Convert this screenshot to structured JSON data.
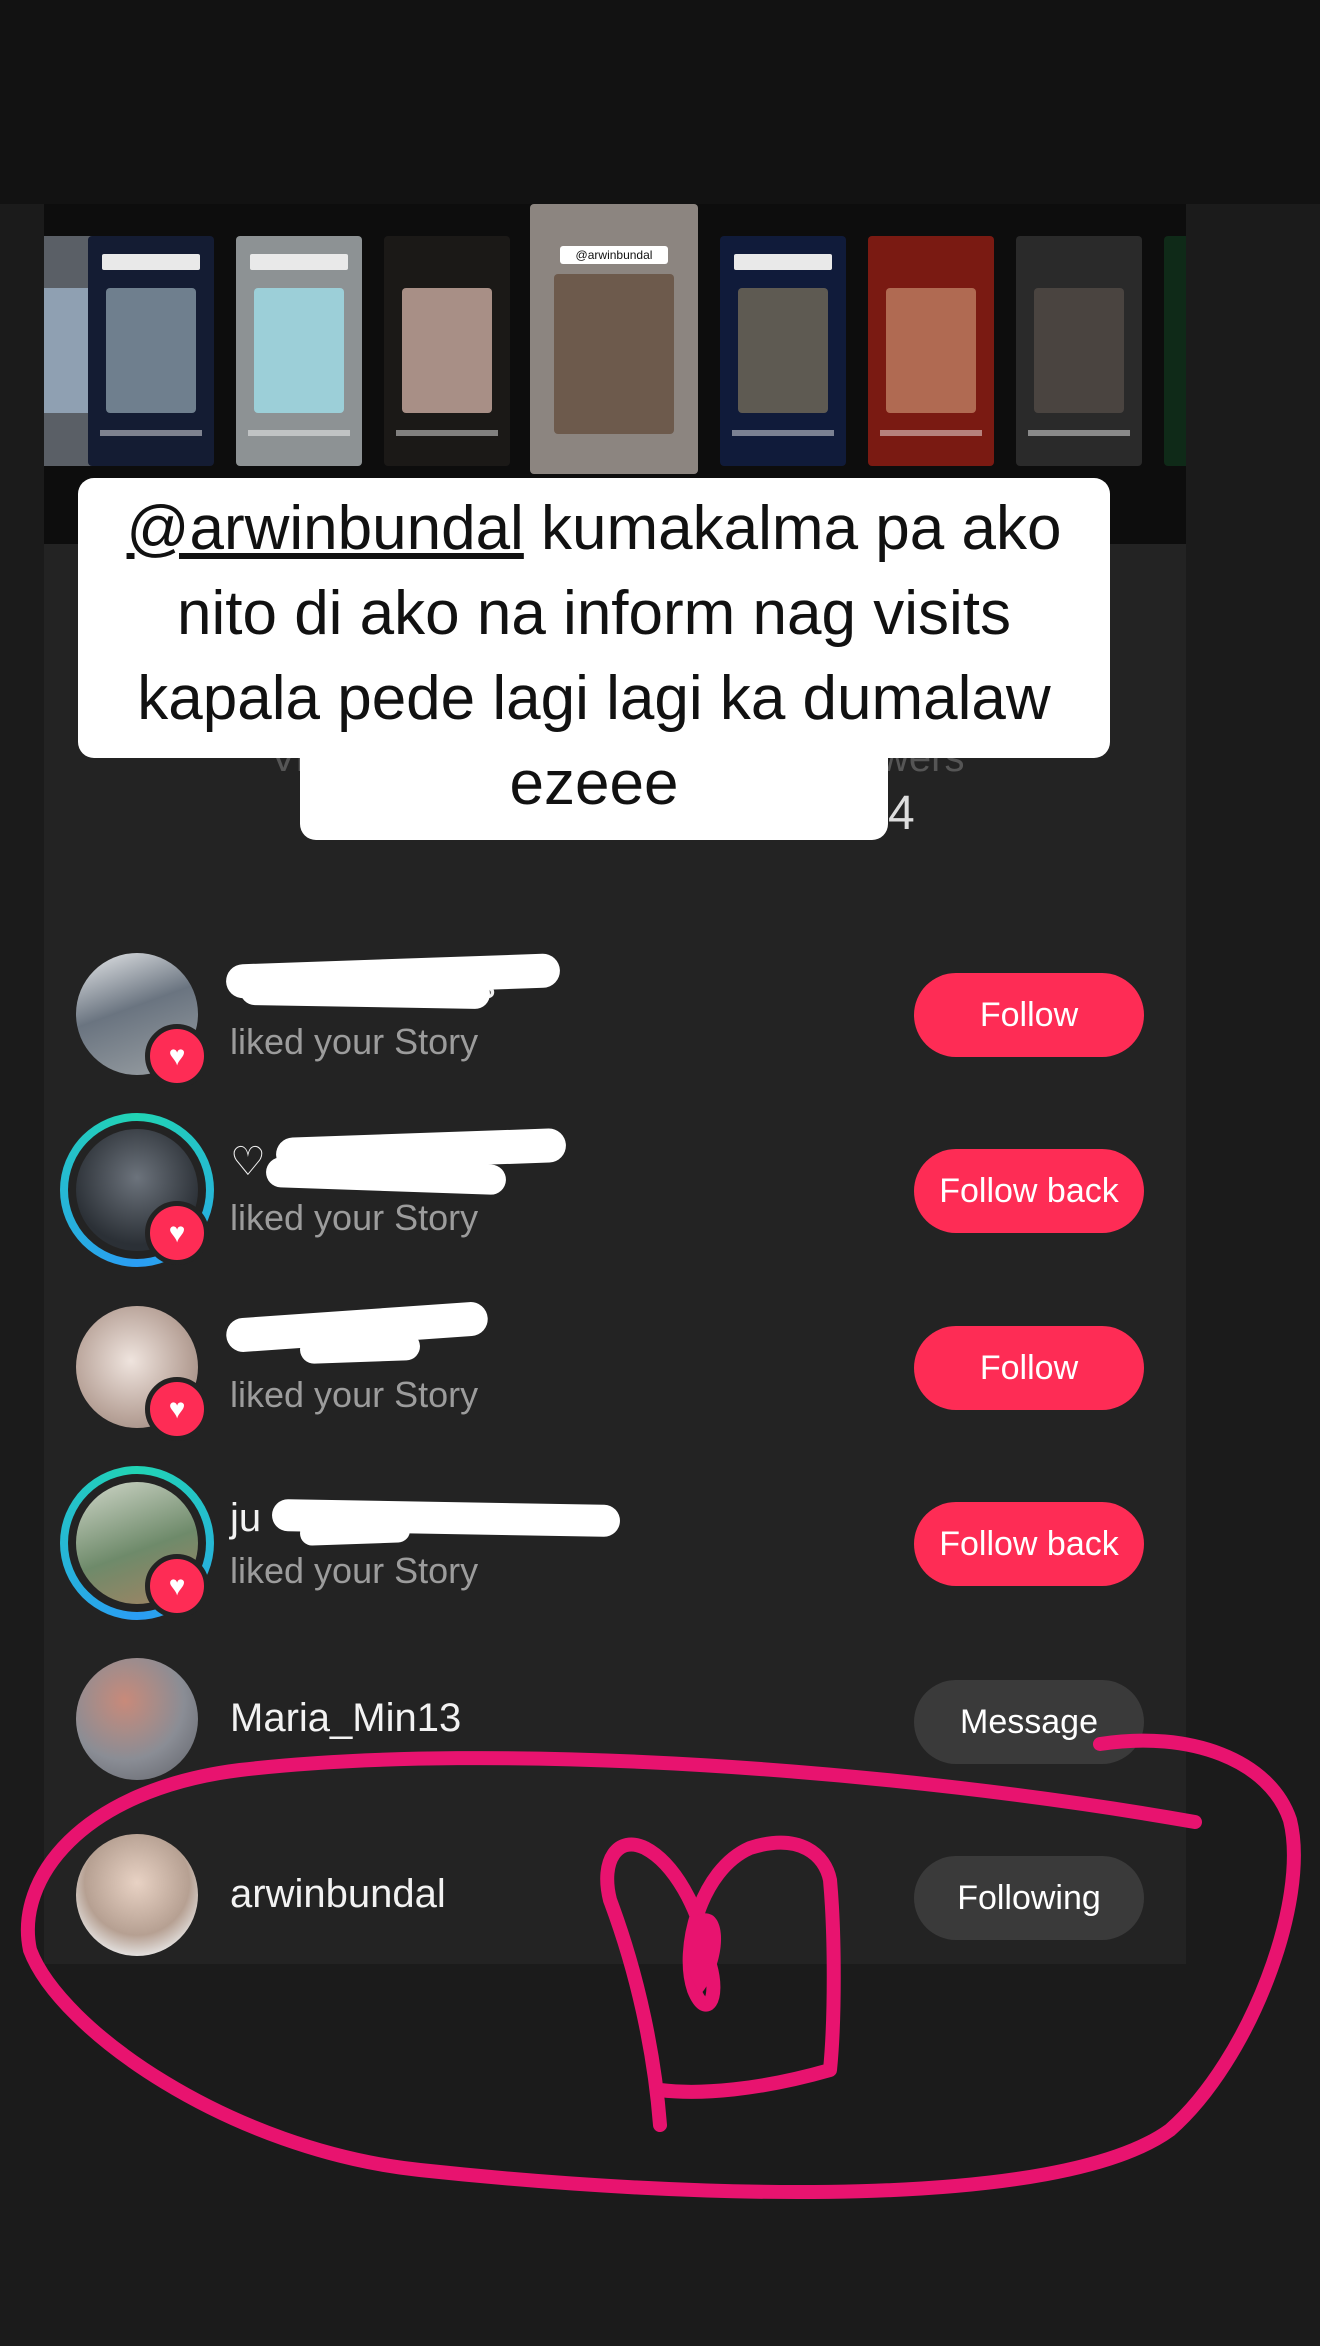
{
  "caption": {
    "mention": "@arwinbundal",
    "text": " kumakalma pa ako nito di ako na inform nag visits kapala pede lagi lagi ka dumalaw ezeee"
  },
  "story_thumbnail": {
    "tag": "@arwinbundal"
  },
  "stats_partial": {
    "left": "Vi",
    "right": "wers",
    "count": "4"
  },
  "rows": [
    {
      "username": "ers",
      "subtitle": "liked your Story",
      "button": "Follow"
    },
    {
      "username": "♡",
      "subtitle": "liked your Story",
      "button": "Follow back"
    },
    {
      "username": "",
      "subtitle": "liked your Story",
      "button": "Follow"
    },
    {
      "username": "ju",
      "subtitle": "liked your Story",
      "button": "Follow back"
    },
    {
      "username": "Maria_Min13",
      "subtitle": "",
      "button": "Message"
    },
    {
      "username": "arwinbundal",
      "subtitle": "",
      "button": "Following"
    }
  ],
  "colors": {
    "accent": "#fe2c55",
    "ink": "#e8136f",
    "ring": "#21d4b4"
  },
  "icons": {
    "badge": "heart-icon"
  }
}
